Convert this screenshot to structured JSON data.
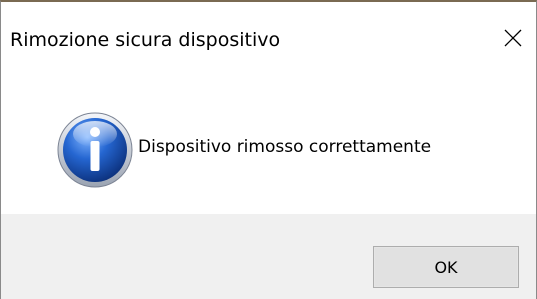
{
  "window": {
    "title": "Rimozione sicura dispositivo",
    "close_icon": "close-icon"
  },
  "content": {
    "icon": "information-icon",
    "message": "Dispositivo rimosso correttamente"
  },
  "footer": {
    "ok_label": "OK"
  },
  "colors": {
    "footer_background": "#f0f0f0",
    "button_background": "#e1e1e1",
    "icon_blue": "#1d5fc4"
  }
}
